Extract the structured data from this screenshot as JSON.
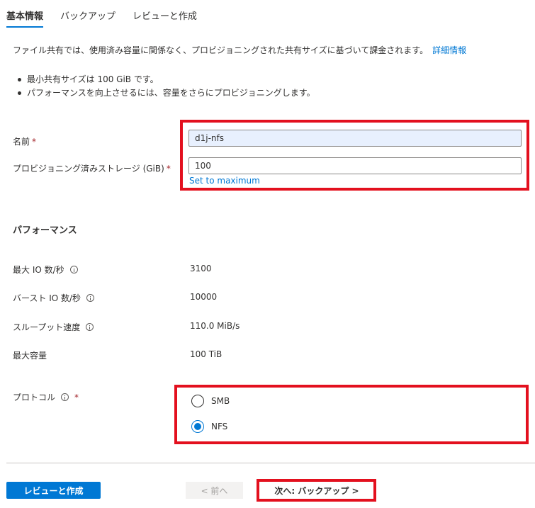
{
  "tabs": [
    {
      "label": "基本情報",
      "active": true
    },
    {
      "label": "バックアップ",
      "active": false
    },
    {
      "label": "レビューと作成",
      "active": false
    }
  ],
  "description": {
    "text": "ファイル共有では、使用済み容量に関係なく、プロビジョニングされた共有サイズに基づいて課金されます。",
    "link": "詳細情報"
  },
  "bullets": [
    "最小共有サイズは 100 GiB です。",
    "パフォーマンスを向上させるには、容量をさらにプロビジョニングします。"
  ],
  "form": {
    "name_label": "名前",
    "name_value": "d1j-nfs",
    "storage_label": "プロビジョニング済みストレージ (GiB)",
    "storage_value": "100",
    "set_max_link": "Set to maximum",
    "required_mark": "*"
  },
  "performance": {
    "title": "パフォーマンス",
    "rows": [
      {
        "label": "最大 IO 数/秒",
        "value": "3100",
        "icon": "info-icon"
      },
      {
        "label": "バースト IO 数/秒",
        "value": "10000",
        "icon": "info-icon"
      },
      {
        "label": "スループット速度",
        "value": "110.0 MiB/s",
        "icon": "info-icon"
      },
      {
        "label": "最大容量",
        "value": "100 TiB"
      }
    ]
  },
  "protocol": {
    "label": "プロトコル",
    "options": [
      {
        "label": "SMB",
        "selected": false
      },
      {
        "label": "NFS",
        "selected": true
      }
    ]
  },
  "footer": {
    "review_button": "レビューと作成",
    "prev_button": "< 前へ",
    "next_button": "次へ: バックアップ >"
  },
  "colors": {
    "accent": "#0078d4",
    "highlight": "#e3101e",
    "required": "#a4262c"
  }
}
